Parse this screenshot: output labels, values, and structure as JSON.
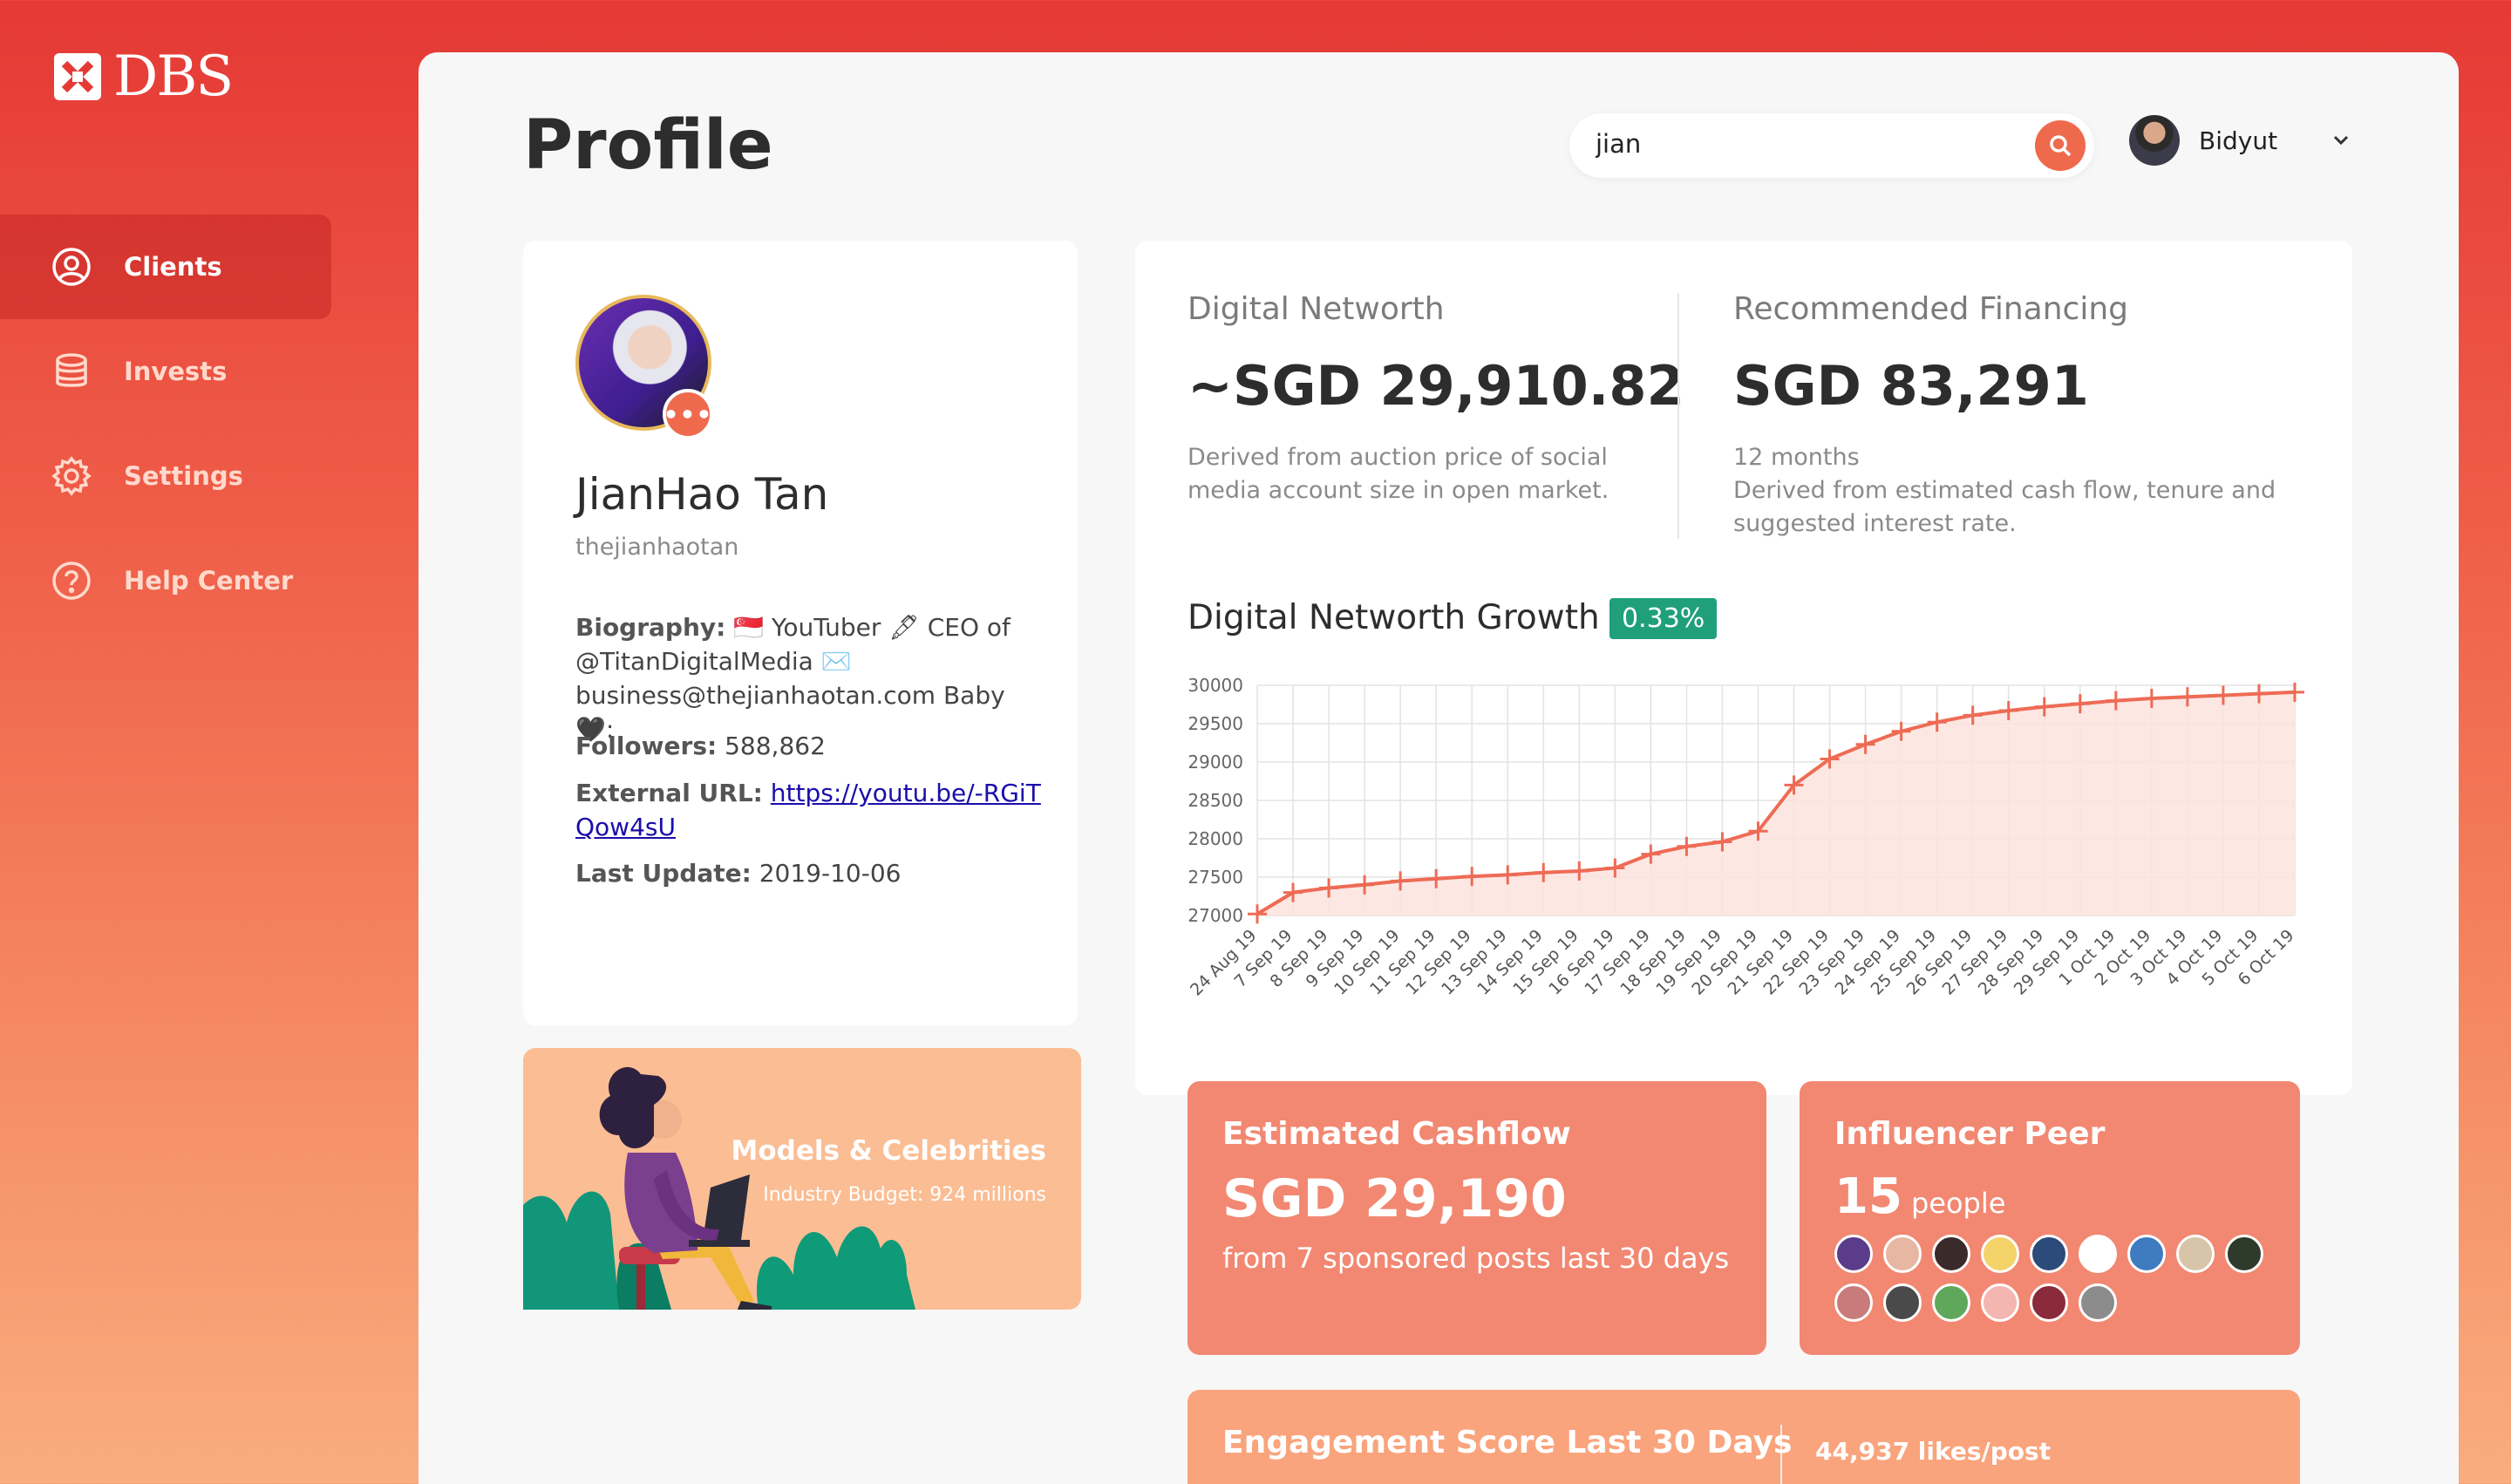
{
  "brand": {
    "name": "DBS"
  },
  "sidebar": {
    "items": [
      {
        "label": "Clients",
        "icon": "user-circle-icon",
        "active": true
      },
      {
        "label": "Invests",
        "icon": "database-icon",
        "active": false
      },
      {
        "label": "Settings",
        "icon": "gear-icon",
        "active": false
      },
      {
        "label": "Help Center",
        "icon": "question-circle-icon",
        "active": false
      }
    ]
  },
  "header": {
    "title": "Profile",
    "search": {
      "value": "jian",
      "placeholder": ""
    },
    "user": {
      "name": "Bidyut"
    }
  },
  "profile": {
    "name": "JianHao Tan",
    "handle": "thejianhaotan",
    "biography_label": "Biography:",
    "biography": "🇸🇬 YouTuber 🖋 CEO of @TitanDigitalMedia ✉️ business@thejianhaotan.com Baby 🖤:",
    "followers_label": "Followers:",
    "followers": "588,862",
    "url_label": "External URL:",
    "url": "https://youtu.be/-RGiTQow4sU",
    "update_label": "Last Update:",
    "update": "2019-10-06"
  },
  "banner": {
    "title": "Models & Celebrities",
    "subtitle": "Industry Budget: 924 millions"
  },
  "networth": {
    "label": "Digital Networth",
    "value": "~SGD 29,910.82",
    "note": "Derived from auction price of social media account size in open market."
  },
  "financing": {
    "label": "Recommended Financing",
    "value": "SGD 83,291",
    "term": "12 months",
    "note": "Derived from estimated cash flow, tenure and suggested interest rate."
  },
  "growth": {
    "title": "Digital Networth Growth",
    "badge": "0.33%"
  },
  "chart_data": {
    "type": "line",
    "title": "",
    "xlabel": "",
    "ylabel": "",
    "ylim": [
      27000,
      30000
    ],
    "yticks": [
      27000,
      27500,
      28000,
      28500,
      29000,
      29500,
      30000
    ],
    "grid": true,
    "line_color": "#ee6b55",
    "fill_color": "#fde3de",
    "x": [
      "24 Aug 19",
      "7 Sep 19",
      "8 Sep 19",
      "9 Sep 19",
      "10 Sep 19",
      "11 Sep 19",
      "12 Sep 19",
      "13 Sep 19",
      "14 Sep 19",
      "15 Sep 19",
      "16 Sep 19",
      "17 Sep 19",
      "18 Sep 19",
      "19 Sep 19",
      "20 Sep 19",
      "21 Sep 19",
      "22 Sep 19",
      "23 Sep 19",
      "24 Sep 19",
      "25 Sep 19",
      "26 Sep 19",
      "27 Sep 19",
      "28 Sep 19",
      "29 Sep 19",
      "1 Oct 19",
      "2 Oct 19",
      "3 Oct 19",
      "4 Oct 19",
      "5 Oct 19",
      "6 Oct 19"
    ],
    "series": [
      {
        "values": [
          27020,
          27300,
          27360,
          27400,
          27450,
          27480,
          27510,
          27530,
          27560,
          27580,
          27620,
          27800,
          27900,
          27960,
          28100,
          28700,
          29040,
          29230,
          29400,
          29520,
          29610,
          29670,
          29720,
          29760,
          29800,
          29830,
          29850,
          29870,
          29890,
          29910
        ]
      }
    ]
  },
  "cashflow": {
    "title": "Estimated Cashflow",
    "value": "SGD 29,190",
    "sub": "from 7 sponsored posts last 30 days"
  },
  "peers": {
    "title": "Influencer Peer",
    "count": "15",
    "unit": "people",
    "colors": [
      "#5a3c8a",
      "#e7b7a3",
      "#3a2a2a",
      "#f5d36b",
      "#2c4a7a",
      "#ffffff",
      "#3e7bbf",
      "#d8c4a8",
      "#2e3b2a",
      "#c97b7b",
      "#4a4a4a",
      "#5fa85b",
      "#f4b6b0",
      "#8a2a3a",
      "#8c8c8c"
    ]
  },
  "engagement": {
    "title": "Engagement Score Last 30 Days",
    "stat": "44,937 likes/post"
  }
}
